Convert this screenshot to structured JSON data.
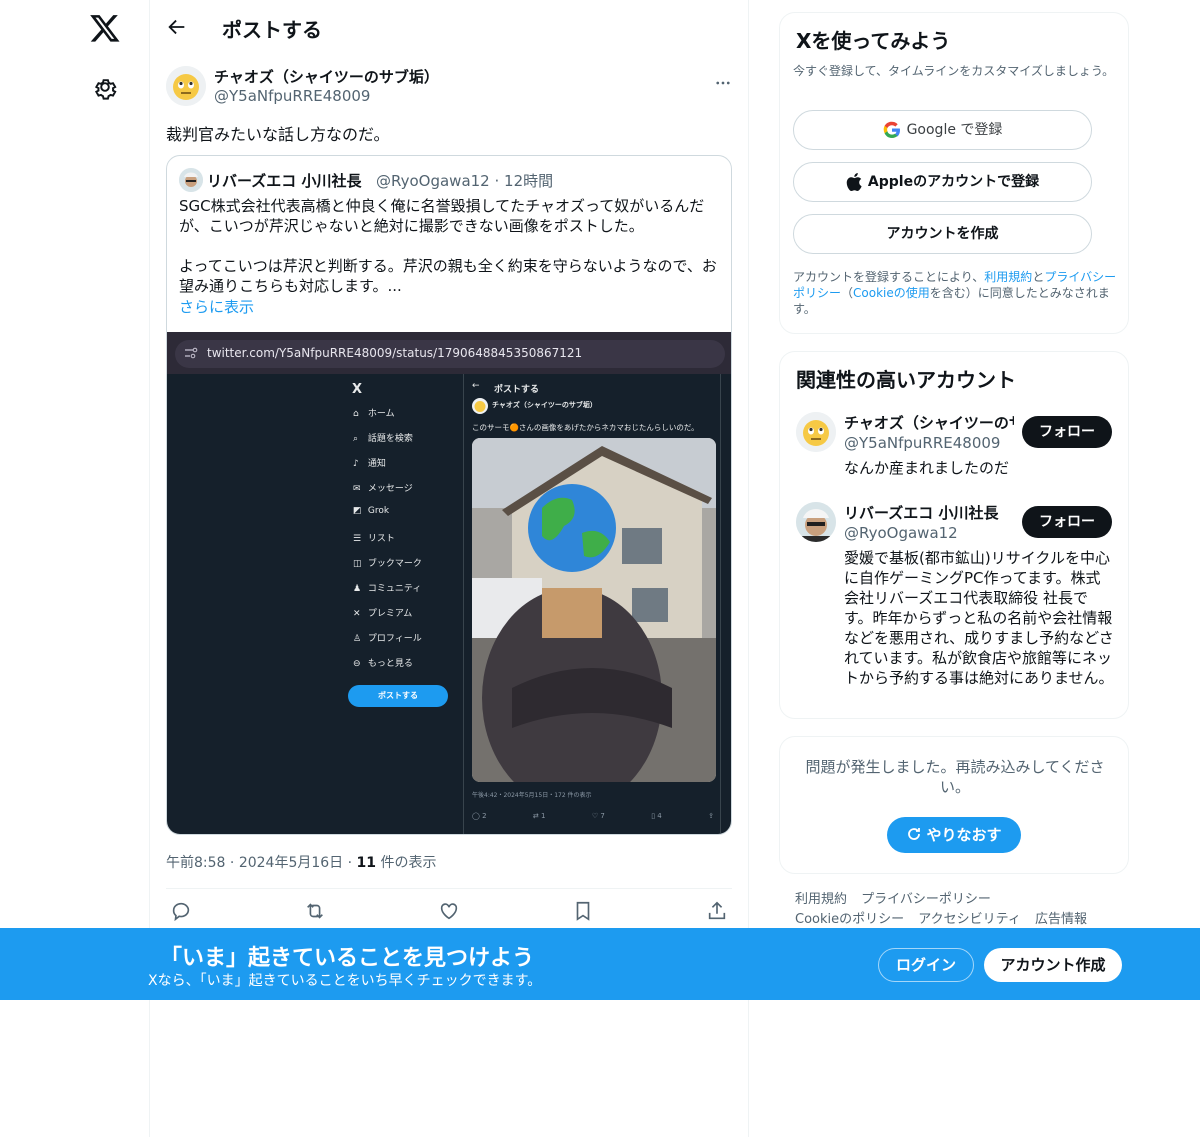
{
  "header": {
    "title": "ポストする"
  },
  "post": {
    "author_name": "チャオズ（シャイツーのサブ垢）",
    "author_handle": "@Y5aNfpuRRE48009",
    "text": "裁判官みたいな話し方なのだ。",
    "time": "午前8:58",
    "date": "2024年5月16日",
    "views_count": "11",
    "views_label": "件の表示"
  },
  "quote": {
    "author_name": "リバーズエコ 小川社長",
    "author_handle": "@RyoOgawa12",
    "time": "12時間",
    "text": "SGC株式会社代表高橋と仲良く俺に名誉毀損してたチャオズって奴がいるんだが、こいつが芹沢じゃないと絶対に撮影できない画像をポストした。\n\nよってこいつは芹沢と判断する。芹沢の親も全く約束を守らないようなので、お望み通りこちらも対応します。...",
    "show_more": "さらに表示"
  },
  "screenshot": {
    "url": "twitter.com/Y5aNfpuRRE48009/status/1790648845350867121",
    "nav_logo": "X",
    "nav_items": [
      "ホーム",
      "話題を検索",
      "通知",
      "メッセージ",
      "Grok",
      "リスト",
      "ブックマーク",
      "コミュニティ",
      "プレミアム",
      "プロフィール",
      "もっと見る"
    ],
    "nav_button": "ポストする",
    "inner_title": "ポストする",
    "inner_name": "チャオズ（シャイツーのサブ垢）",
    "inner_text": "このサーモ🟠さんの画像をあげたからネカマおじたんらしいのだ。",
    "inner_meta": "午後4:42・2024年5月15日・172 件の表示",
    "inner_counts": [
      "2",
      "1",
      "7",
      "4"
    ]
  },
  "signup": {
    "title": "Xを使ってみよう",
    "subtitle": "今すぐ登録して、タイムラインをカスタマイズしましょう。",
    "google": "Google で登録",
    "apple": "Appleのアカウントで登録",
    "create": "アカウントを作成",
    "terms_1": "アカウントを登録することにより、",
    "terms_link1": "利用規約",
    "terms_2": "と",
    "terms_link2": "プライバシーポリシー",
    "terms_3": "（",
    "terms_link3": "Cookieの使用",
    "terms_4": "を含む）に同意したとみなされます。"
  },
  "related": {
    "title": "関連性の高いアカウント",
    "follow_label": "フォロー",
    "accounts": [
      {
        "name": "チャオズ（シャイツーのサブ垢）",
        "handle": "@Y5aNfpuRRE48009",
        "bio": "なんか産まれましたのだ"
      },
      {
        "name": "リバーズエコ 小川社長",
        "handle": "@RyoOgawa12",
        "bio": "愛媛で基板(都市鉱山)リサイクルを中心に自作ゲーミングPC作ってます。株式会社リバーズエコ代表取締役 社長です。昨年からずっと私の名前や会社情報などを悪用され、成りすまし予約などされています。私が飲食店や旅館等にネットから予約する事は絶対にありません。"
      }
    ]
  },
  "error": {
    "message": "問題が発生しました。再読み込みしてください。",
    "retry": "やりなおす"
  },
  "footer": {
    "links": [
      "利用規約",
      "プライバシーポリシー",
      "Cookieのポリシー",
      "アクセシビリティ",
      "広告情報"
    ]
  },
  "banner": {
    "title": "「いま」起きていることを見つけよう",
    "subtitle": "Xなら、「いま」起きていることをいち早くチェックできます。",
    "login": "ログイン",
    "signup": "アカウント作成"
  },
  "colors": {
    "accent": "#1d9bf0",
    "text": "#0f1419",
    "muted": "#536471"
  }
}
